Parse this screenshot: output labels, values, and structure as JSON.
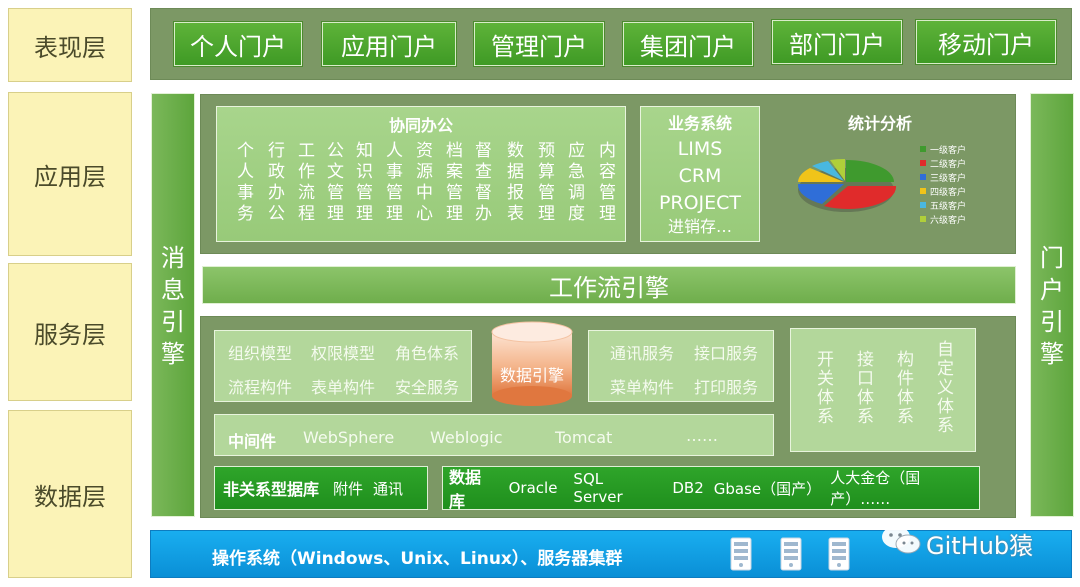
{
  "layers": [
    "表现层",
    "应用层",
    "服务层",
    "数据层"
  ],
  "portals": [
    "个人门户",
    "应用门户",
    "管理门户",
    "集团门户",
    "部门门户",
    "移动门户"
  ],
  "collab": {
    "title": "协同办公",
    "columns": [
      "个人事务",
      "行政办公",
      "工作流程",
      "公文管理",
      "知识管理",
      "人事管理",
      "资源中心",
      "档案管理",
      "督查督办",
      "数据报表",
      "预算管理",
      "应急调度",
      "内容管理"
    ]
  },
  "biz": {
    "title": "业务系统",
    "items": [
      "LIMS",
      "CRM",
      "PROJECT",
      "进销存…"
    ]
  },
  "stats": {
    "title": "统计分析",
    "legend": [
      "一级客户",
      "二级客户",
      "三级客户",
      "四级客户",
      "五级客户",
      "六级客户"
    ],
    "colors": [
      "#3f9a2e",
      "#e02b2b",
      "#2f6ed8",
      "#f0c419",
      "#49b8e0",
      "#b0cf3a"
    ]
  },
  "workflow_engine": "工作流引擎",
  "message_engine": [
    "消",
    "息",
    "引",
    "擎"
  ],
  "portal_engine": [
    "门",
    "户",
    "引",
    "擎"
  ],
  "services": {
    "left_row1": [
      "组织模型",
      "权限模型",
      "角色体系"
    ],
    "left_row2": [
      "流程构件",
      "表单构件",
      "安全服务"
    ],
    "data_engine": "数据引擎",
    "mid_row1": [
      "通讯服务",
      "接口服务"
    ],
    "mid_row2": [
      "菜单构件",
      "打印服务"
    ],
    "systems": [
      "开关体系",
      "接口体系",
      "构件体系",
      "自定义体系"
    ]
  },
  "middleware": {
    "label": "中间件",
    "items": [
      "WebSphere",
      "Weblogic",
      "Tomcat",
      "……"
    ]
  },
  "nosql": {
    "label": "非关系型据库",
    "items": [
      "附件",
      "通讯"
    ]
  },
  "database": {
    "label": "数据库",
    "items": [
      "Oracle",
      "SQL Server",
      "DB2",
      "Gbase（国产）",
      "人大金仓（国产）……"
    ]
  },
  "os_bar": "操作系统（Windows、Unix、Linux）、服务器集群",
  "watermark": "GitHub猿"
}
